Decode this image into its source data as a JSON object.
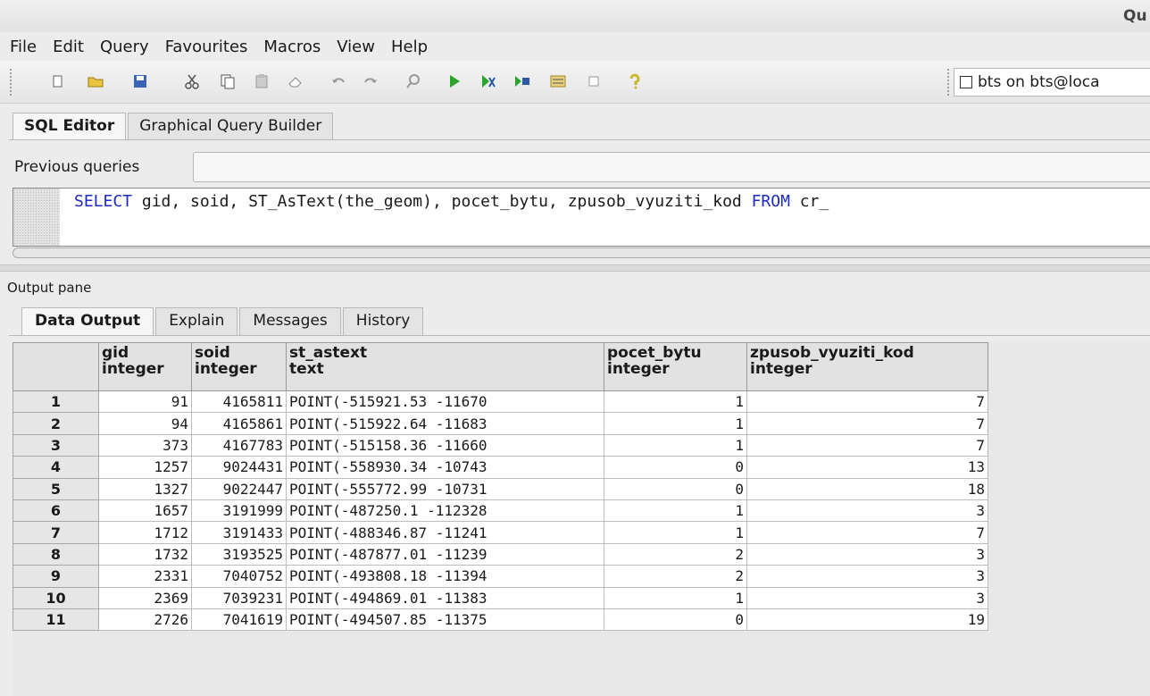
{
  "window": {
    "title": "Qu"
  },
  "menu": [
    "File",
    "Edit",
    "Query",
    "Favourites",
    "Macros",
    "View",
    "Help"
  ],
  "toolbar": {
    "connection_label": "bts on bts@loca"
  },
  "editor_tabs": [
    "SQL Editor",
    "Graphical Query Builder"
  ],
  "previous_queries_label": "Previous queries",
  "sql": {
    "kw1": "SELECT",
    "mid": " gid, soid, ST_AsText(the_geom), pocet_bytu, zpusob_vyuziti_kod ",
    "kw2": "FROM",
    "tail": " cr_"
  },
  "output_pane_label": "Output pane",
  "output_tabs": [
    "Data Output",
    "Explain",
    "Messages",
    "History"
  ],
  "grid": {
    "columns": [
      {
        "name": "gid",
        "type": "integer"
      },
      {
        "name": "soid",
        "type": "integer"
      },
      {
        "name": "st_astext",
        "type": "text"
      },
      {
        "name": "pocet_bytu",
        "type": "integer"
      },
      {
        "name": "zpusob_vyuziti_kod",
        "type": "integer"
      }
    ],
    "rows": [
      {
        "n": "1",
        "gid": "91",
        "soid": "4165811",
        "geom": "POINT(-515921.53 -11670",
        "pocet": "1",
        "kod": "7"
      },
      {
        "n": "2",
        "gid": "94",
        "soid": "4165861",
        "geom": "POINT(-515922.64 -11683",
        "pocet": "1",
        "kod": "7"
      },
      {
        "n": "3",
        "gid": "373",
        "soid": "4167783",
        "geom": "POINT(-515158.36 -11660",
        "pocet": "1",
        "kod": "7"
      },
      {
        "n": "4",
        "gid": "1257",
        "soid": "9024431",
        "geom": "POINT(-558930.34 -10743",
        "pocet": "0",
        "kod": "13"
      },
      {
        "n": "5",
        "gid": "1327",
        "soid": "9022447",
        "geom": "POINT(-555772.99 -10731",
        "pocet": "0",
        "kod": "18"
      },
      {
        "n": "6",
        "gid": "1657",
        "soid": "3191999",
        "geom": "POINT(-487250.1 -112328",
        "pocet": "1",
        "kod": "3"
      },
      {
        "n": "7",
        "gid": "1712",
        "soid": "3191433",
        "geom": "POINT(-488346.87 -11241",
        "pocet": "1",
        "kod": "7"
      },
      {
        "n": "8",
        "gid": "1732",
        "soid": "3193525",
        "geom": "POINT(-487877.01 -11239",
        "pocet": "2",
        "kod": "3"
      },
      {
        "n": "9",
        "gid": "2331",
        "soid": "7040752",
        "geom": "POINT(-493808.18 -11394",
        "pocet": "2",
        "kod": "3"
      },
      {
        "n": "10",
        "gid": "2369",
        "soid": "7039231",
        "geom": "POINT(-494869.01 -11383",
        "pocet": "1",
        "kod": "3"
      },
      {
        "n": "11",
        "gid": "2726",
        "soid": "7041619",
        "geom": "POINT(-494507.85 -11375",
        "pocet": "0",
        "kod": "19"
      }
    ]
  },
  "colors": {
    "sql_keyword": "#1d2bbf"
  }
}
